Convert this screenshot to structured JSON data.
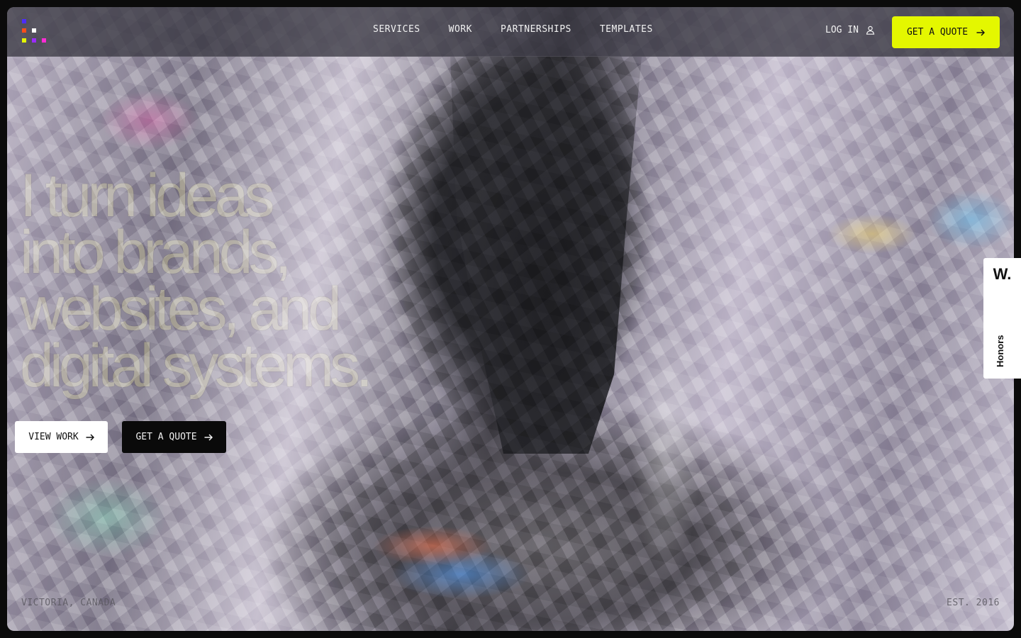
{
  "header": {
    "logo_colors": [
      "#4b2bff",
      "#ff4d1a",
      "#ffffff",
      "#e4f700",
      "#9b2bff",
      "#ff2bd6"
    ],
    "nav": [
      {
        "label": "SERVICES"
      },
      {
        "label": "WORK"
      },
      {
        "label": "PARTNERSHIPS"
      },
      {
        "label": "TEMPLATES"
      }
    ],
    "login_label": "LOG IN",
    "login_icon": "user-icon",
    "cta_label": "GET A QUOTE",
    "cta_icon": "arrow-right-icon",
    "accent_color": "#e4f700"
  },
  "hero": {
    "headline_lines": [
      "I turn ideas",
      "into brands,",
      "websites, and",
      "digital systems."
    ],
    "primary_button": {
      "label": "VIEW WORK",
      "icon": "arrow-right-icon"
    },
    "secondary_button": {
      "label": "GET A QUOTE",
      "icon": "arrow-right-icon"
    }
  },
  "footer": {
    "location": "VICTORIA, CANADA",
    "established": "EST. 2016"
  },
  "honors_tab": {
    "logo": "W.",
    "label": "Honors"
  }
}
